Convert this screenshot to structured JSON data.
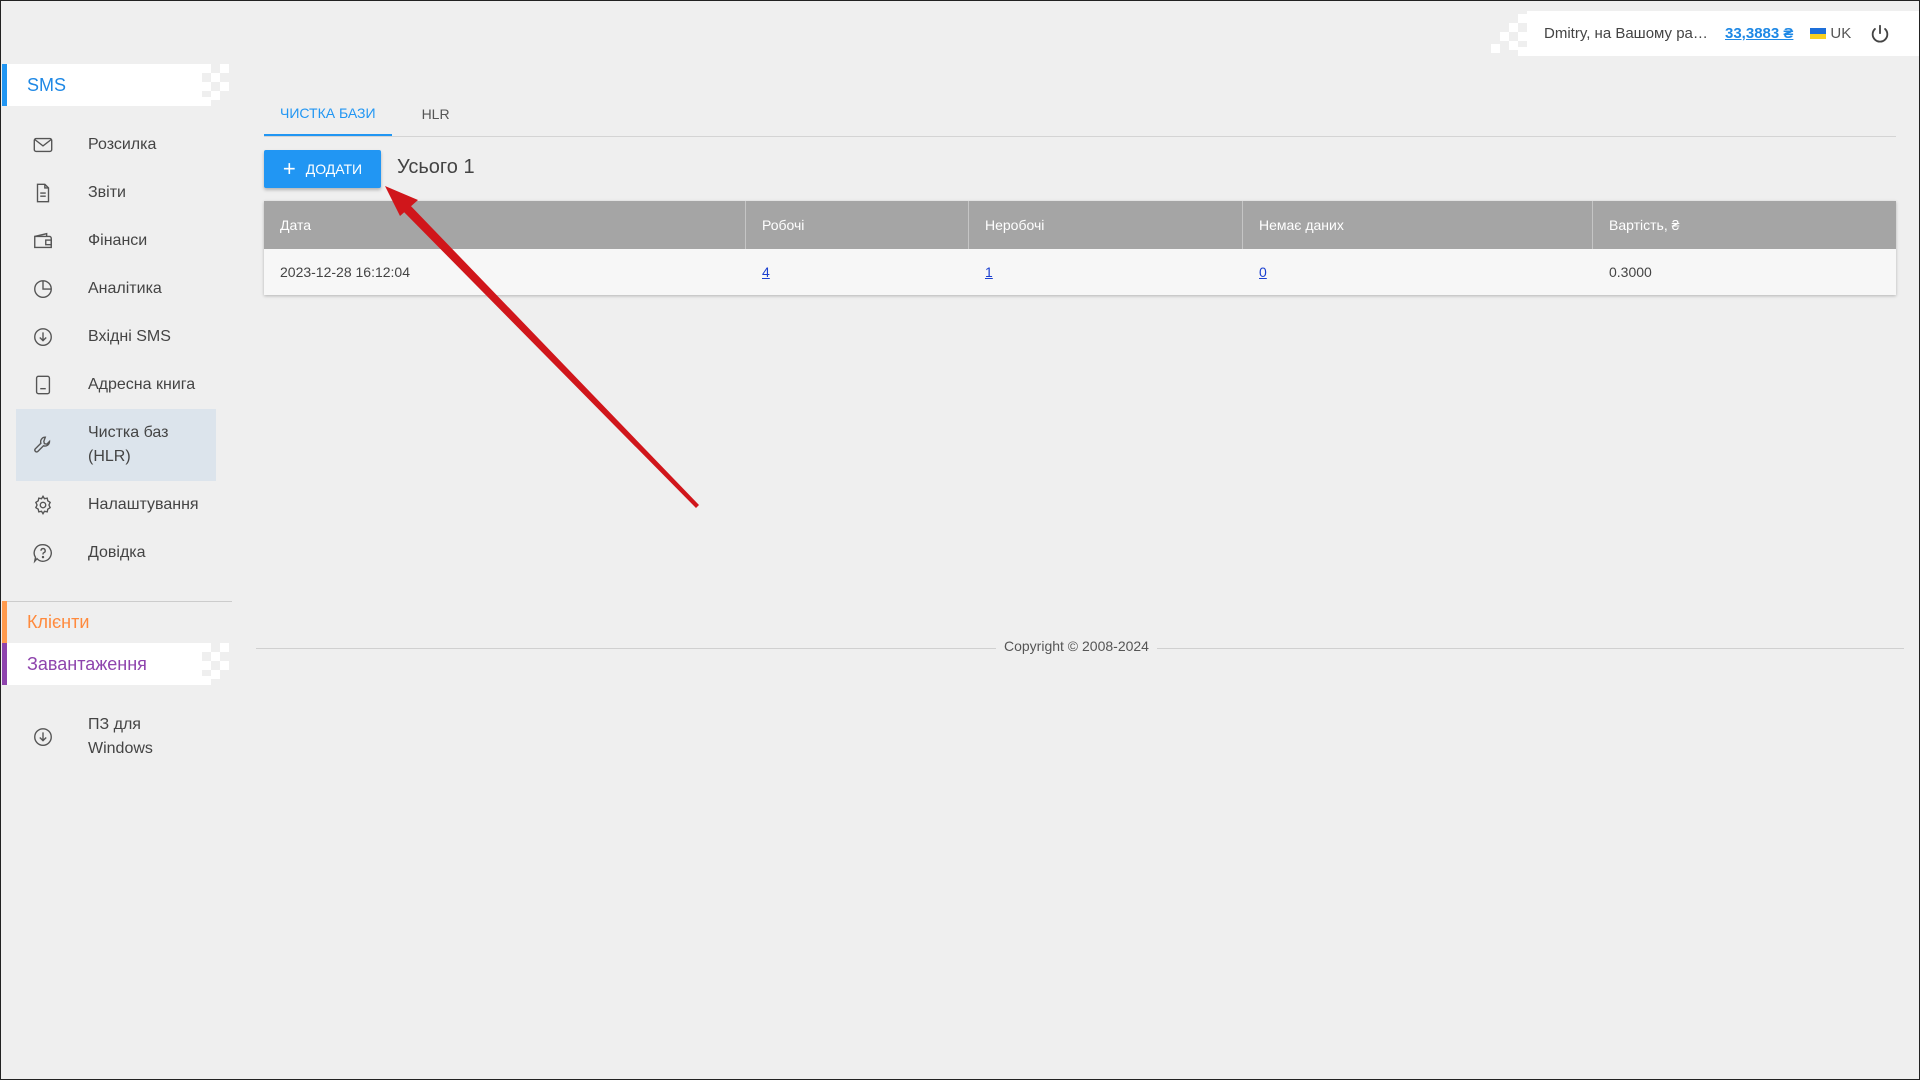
{
  "header": {
    "user_text": "Dmitry, на Вашому рахунку",
    "balance": "33,3883 ₴",
    "language": "UK"
  },
  "sidebar": {
    "sms_title": "SMS",
    "items": [
      {
        "label": "Розсилка",
        "icon": "mail-icon"
      },
      {
        "label": "Звіти",
        "icon": "document-icon"
      },
      {
        "label": "Фінанси",
        "icon": "wallet-icon"
      },
      {
        "label": "Аналітика",
        "icon": "pie-chart-icon"
      },
      {
        "label": "Вхідні SMS",
        "icon": "download-circle-icon"
      },
      {
        "label": "Адресна книга",
        "icon": "address-book-icon"
      },
      {
        "label": "Чистка баз (HLR)",
        "icon": "wrench-icon",
        "active": true
      },
      {
        "label": "Налаштування",
        "icon": "gear-icon"
      },
      {
        "label": "Довідка",
        "icon": "help-icon"
      }
    ],
    "clients_title": "Клієнти",
    "downloads_title": "Завантаження",
    "download_items": [
      {
        "label": "ПЗ для Windows",
        "icon": "download-circle-icon"
      }
    ]
  },
  "tabs": [
    {
      "label": "ЧИСТКА БАЗИ",
      "active": true
    },
    {
      "label": "HLR",
      "active": false
    }
  ],
  "toolbar": {
    "add_label": "ДОДАТИ",
    "total_label": "Усього 1"
  },
  "table": {
    "columns": [
      "Дата",
      "Робочі",
      "Неробочі",
      "Немає даних",
      "Вартість, ₴"
    ],
    "rows": [
      {
        "date": "2023-12-28 16:12:04",
        "working": "4",
        "nonworking": "1",
        "nodata": "0",
        "cost": "0.3000"
      }
    ]
  },
  "footer": {
    "copyright": "Copyright © 2008-2024"
  },
  "colors": {
    "accent": "#2196f3",
    "clients": "#ff8a3d",
    "downloads": "#8e44ad",
    "annotation_arrow": "#d0161b"
  }
}
